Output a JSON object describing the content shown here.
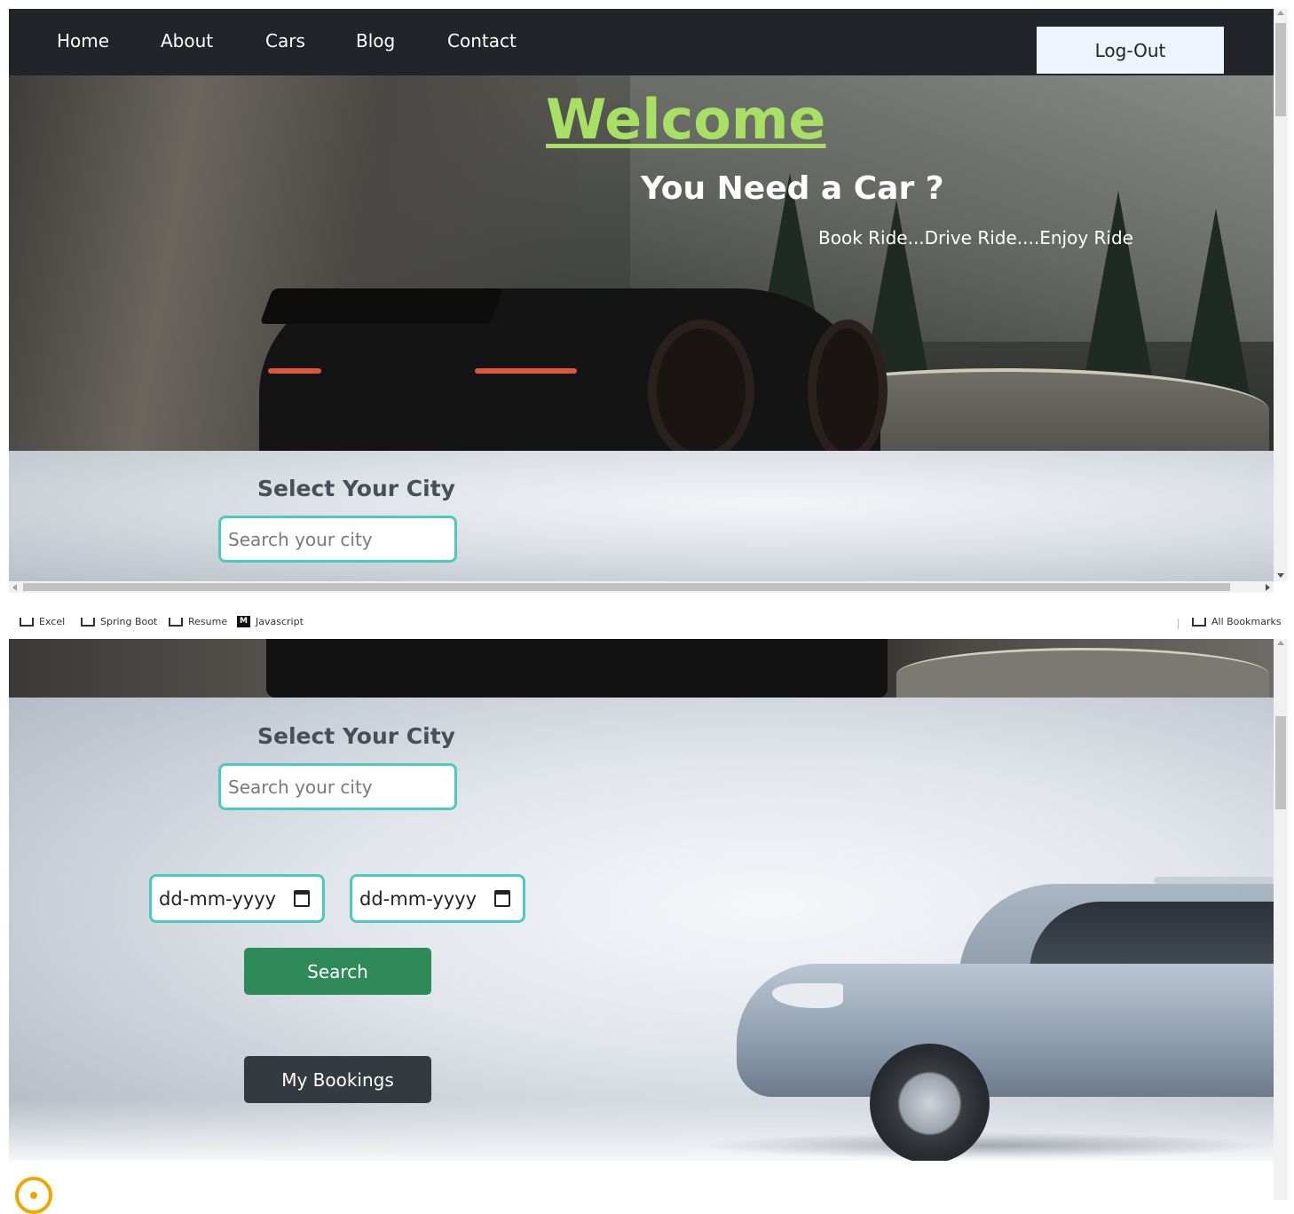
{
  "navbar": {
    "links": [
      "Home",
      "About",
      "Cars",
      "Blog",
      "Contact"
    ],
    "logout_label": "Log-Out"
  },
  "hero": {
    "welcome": "Welcome",
    "headline": "You Need a Car ?",
    "tagline": "Book Ride...Drive Ride....Enjoy Ride"
  },
  "city": {
    "title": "Select Your City",
    "placeholder": "Search your city"
  },
  "bookmarks": {
    "items": [
      "Excel",
      "Spring Boot",
      "Resume",
      "Javascript"
    ],
    "all_label": "All Bookmarks"
  },
  "booking_form": {
    "date_from_placeholder": "dd-mm-yyyy",
    "date_to_placeholder": "dd-mm-yyyy",
    "search_label": "Search",
    "my_bookings_label": "My Bookings"
  },
  "colors": {
    "navbar_bg": "#212529",
    "welcome_color": "#a8e063",
    "input_border": "#4cc9c0",
    "search_btn": "#2e8b57",
    "bookings_btn": "#343a40",
    "circle_icon": "#f0a800"
  },
  "icons": {
    "calendar": "calendar-icon",
    "folder": "folder-icon",
    "bottom_left": "circle-dot-icon"
  }
}
